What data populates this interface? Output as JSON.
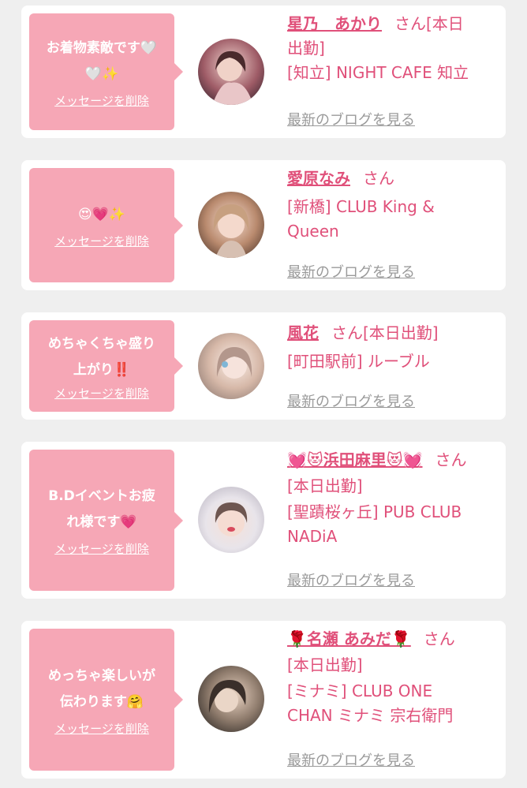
{
  "delete_label": "メッセージを削除",
  "blog_label": "最新のブログを見る",
  "colors": {
    "accent": "#e0507a",
    "bubble": "#f6a7b6",
    "background": "#efefef"
  },
  "messages": [
    {
      "text_lines": [
        "お着物素敵です🤍",
        "🤍✨"
      ],
      "name": "星乃　あかり",
      "san": "さん",
      "detail_lines": [
        "[本日",
        "出勤]",
        "[知立] NIGHT CAFE 知立"
      ],
      "avatar_icon": "woman-photo-avatar-icon"
    },
    {
      "text_lines": [
        "😍💗✨"
      ],
      "name": "愛原なみ",
      "san": "さん",
      "detail_lines": [
        "",
        "[新橋] CLUB King &",
        "Queen"
      ],
      "avatar_icon": "woman-photo-avatar-icon"
    },
    {
      "text_lines": [
        "めちゃくちゃ盛り",
        "上がり‼️"
      ],
      "name": "風花",
      "san": "さん",
      "detail_lines": [
        "[本日出勤]",
        "[町田駅前] ルーブル"
      ],
      "avatar_icon": "woman-photo-avatar-icon"
    },
    {
      "text_lines": [
        "B.Dイベントお疲",
        "れ様です💗"
      ],
      "name": "💓😻浜田麻里😻💓",
      "san": "さん",
      "detail_lines": [
        "[本日出勤]",
        "[聖蹟桜ヶ丘] PUB CLUB",
        "NADiA"
      ],
      "avatar_icon": "woman-photo-avatar-icon"
    },
    {
      "text_lines": [
        "めっちゃ楽しいが",
        "伝わります🤗"
      ],
      "name": "🌹名瀬 あみだ🌹",
      "san": "さん",
      "detail_lines": [
        "[本日出勤]",
        "[ミナミ] CLUB ONE",
        "CHAN ミナミ 宗右衛門"
      ],
      "avatar_icon": "woman-photo-avatar-icon"
    }
  ]
}
